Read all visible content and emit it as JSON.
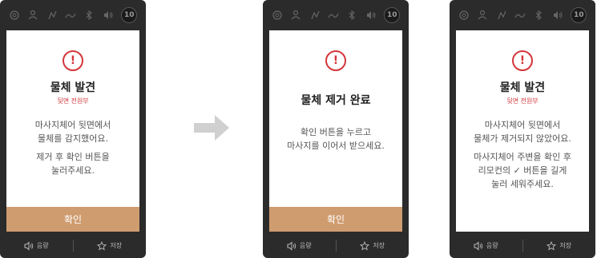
{
  "screens": [
    {
      "status_icons": [
        "settings-icon",
        "user-icon",
        "leg-icon",
        "wave-icon",
        "bluetooth-icon",
        "speaker-icon"
      ],
      "timer": "10",
      "title": "물체 발견",
      "subtitle": "뒷면 전원부",
      "message_lines": [
        "마사지체어 뒷면에서",
        "물체를 감지했어요."
      ],
      "message2_lines": [
        "제거 후 확인 버튼을",
        "눌러주세요."
      ],
      "confirm_label": "확인",
      "volume_label": "음량",
      "save_label": "저장"
    },
    {
      "status_icons": [
        "settings-icon",
        "user-icon",
        "leg-icon",
        "wave-icon",
        "bluetooth-icon",
        "speaker-icon"
      ],
      "timer": "10",
      "title": "물체 제거 완료",
      "subtitle": "",
      "message_lines": [
        "확인 버튼을 누르고",
        "마사지를 이어서 받으세요."
      ],
      "message2_lines": [],
      "confirm_label": "확인",
      "volume_label": "음량",
      "save_label": "저장"
    },
    {
      "status_icons": [
        "settings-icon",
        "user-icon",
        "leg-icon",
        "wave-icon",
        "bluetooth-icon",
        "speaker-icon"
      ],
      "timer": "10",
      "title": "물체 발견",
      "subtitle": "뒷면 전원부",
      "message_lines": [
        "마사지체어 뒷면에서",
        "물체가 제거되지 않았어요."
      ],
      "message2_lines": [
        "마사지체어 주변을 확인 후",
        "리모컨의 ✓ 버튼을 길게",
        "눌러 세워주세요."
      ],
      "confirm_label": "",
      "volume_label": "음량",
      "save_label": "저장"
    }
  ],
  "colors": {
    "accent": "#cf9c70",
    "alert": "#d3363a",
    "device": "#2b2b2b"
  }
}
